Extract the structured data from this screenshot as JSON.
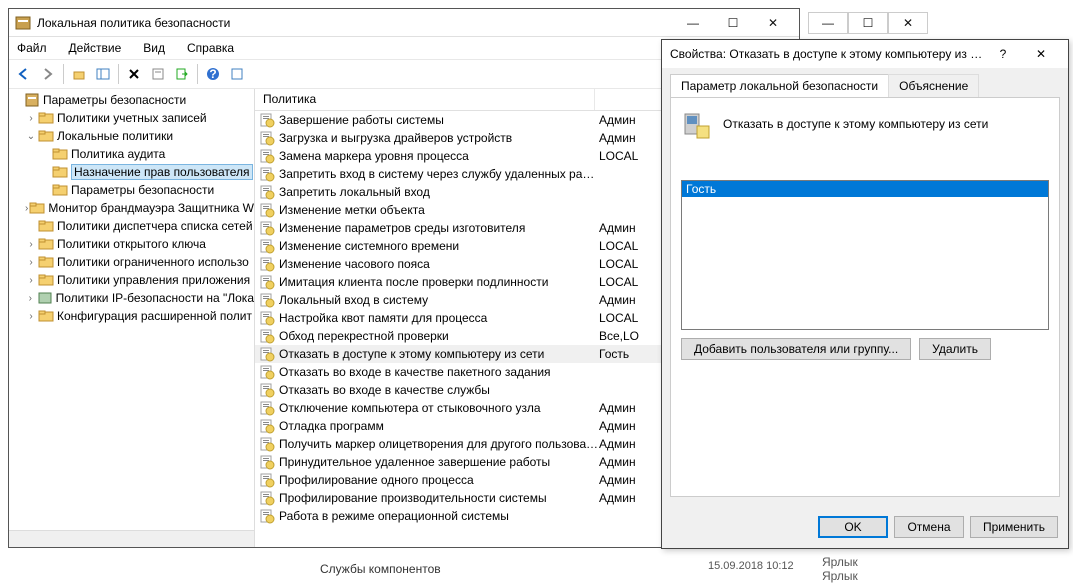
{
  "main": {
    "title": "Локальная политика безопасности",
    "menu": [
      "Файл",
      "Действие",
      "Вид",
      "Справка"
    ],
    "tree": [
      {
        "indent": 0,
        "expander": "",
        "icon": "shield",
        "label": "Параметры безопасности"
      },
      {
        "indent": 1,
        "expander": "›",
        "icon": "folder",
        "label": "Политики учетных записей"
      },
      {
        "indent": 1,
        "expander": "⌄",
        "icon": "folder",
        "label": "Локальные политики"
      },
      {
        "indent": 2,
        "expander": "",
        "icon": "folder",
        "label": "Политика аудита"
      },
      {
        "indent": 2,
        "expander": "",
        "icon": "folder",
        "label": "Назначение прав пользователя",
        "selected": true
      },
      {
        "indent": 2,
        "expander": "",
        "icon": "folder",
        "label": "Параметры безопасности"
      },
      {
        "indent": 1,
        "expander": "›",
        "icon": "folder",
        "label": "Монитор брандмауэра Защитника W"
      },
      {
        "indent": 1,
        "expander": "",
        "icon": "folder",
        "label": "Политики диспетчера списка сетей"
      },
      {
        "indent": 1,
        "expander": "›",
        "icon": "folder",
        "label": "Политики открытого ключа"
      },
      {
        "indent": 1,
        "expander": "›",
        "icon": "folder",
        "label": "Политики ограниченного использо"
      },
      {
        "indent": 1,
        "expander": "›",
        "icon": "folder",
        "label": "Политики управления приложения"
      },
      {
        "indent": 1,
        "expander": "›",
        "icon": "ip",
        "label": "Политики IP-безопасности на \"Лока"
      },
      {
        "indent": 1,
        "expander": "›",
        "icon": "folder",
        "label": "Конфигурация расширенной полит"
      }
    ],
    "columns": {
      "policy": "Политика",
      "setting": ""
    },
    "policies": [
      {
        "name": "Завершение работы системы",
        "val": "Админ"
      },
      {
        "name": "Загрузка и выгрузка драйверов устройств",
        "val": "Админ"
      },
      {
        "name": "Замена маркера уровня процесса",
        "val": "LOCAL"
      },
      {
        "name": "Запретить вход в систему через службу удаленных рабоч...",
        "val": ""
      },
      {
        "name": "Запретить локальный вход",
        "val": ""
      },
      {
        "name": "Изменение метки объекта",
        "val": ""
      },
      {
        "name": "Изменение параметров среды изготовителя",
        "val": "Админ"
      },
      {
        "name": "Изменение системного времени",
        "val": "LOCAL"
      },
      {
        "name": "Изменение часового пояса",
        "val": "LOCAL"
      },
      {
        "name": "Имитация клиента после проверки подлинности",
        "val": "LOCAL"
      },
      {
        "name": "Локальный вход в систему",
        "val": "Админ"
      },
      {
        "name": "Настройка квот памяти для процесса",
        "val": "LOCAL"
      },
      {
        "name": "Обход перекрестной проверки",
        "val": "Все,LO"
      },
      {
        "name": "Отказать в доступе к этому компьютеру из сети",
        "val": "Гость",
        "selected": true
      },
      {
        "name": "Отказать во входе в качестве пакетного задания",
        "val": ""
      },
      {
        "name": "Отказать во входе в качестве службы",
        "val": ""
      },
      {
        "name": "Отключение компьютера от стыковочного узла",
        "val": "Админ"
      },
      {
        "name": "Отладка программ",
        "val": "Админ"
      },
      {
        "name": "Получить маркер олицетворения для другого пользоват...",
        "val": "Админ"
      },
      {
        "name": "Принудительное удаленное завершение работы",
        "val": "Админ"
      },
      {
        "name": "Профилирование одного процесса",
        "val": "Админ"
      },
      {
        "name": "Профилирование производительности системы",
        "val": "Админ"
      },
      {
        "name": "Работа в режиме операционной системы",
        "val": ""
      }
    ]
  },
  "dialog": {
    "title": "Свойства: Отказать в доступе к этому компьютеру из с…",
    "tabs": {
      "active": "Параметр локальной безопасности",
      "inactive": "Объяснение"
    },
    "policy_name": "Отказать в доступе к этому компьютеру из сети",
    "members": [
      "Гость"
    ],
    "buttons": {
      "add": "Добавить пользователя или группу...",
      "remove": "Удалить",
      "ok": "OK",
      "cancel": "Отмена",
      "apply": "Применить"
    }
  },
  "bg": {
    "time": "15.09.2018 10:12",
    "label1": "Ярлык",
    "label2": "Ярлык",
    "svc": "Службы компонентов"
  }
}
